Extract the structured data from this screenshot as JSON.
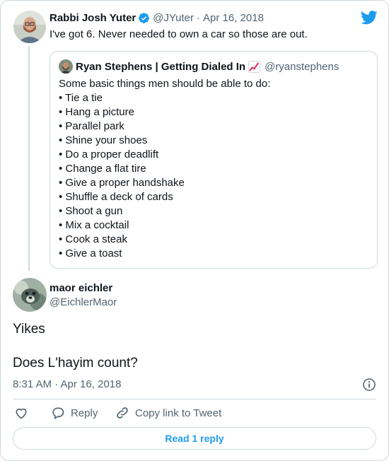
{
  "tweet1": {
    "name": "Rabbi Josh Yuter",
    "handle": "@JYuter",
    "dot": "·",
    "date": "Apr 16, 2018",
    "text": "I've got 6. Never needed to own a car so those are out."
  },
  "quoted": {
    "name": "Ryan Stephens | Getting Dialed In",
    "handle": "@ryanstephens",
    "intro": "Some basic things men should be able to do:",
    "items": [
      "• Tie a tie",
      "• Hang a picture",
      "• Parallel park",
      "• Shine your shoes",
      "• Do a proper deadlift",
      "• Change a flat tire",
      "• Give a proper handshake",
      "• Shuffle a deck of cards",
      "• Shoot a gun",
      "• Mix a cocktail",
      "• Cook a steak",
      "• Give a toast"
    ]
  },
  "tweet2": {
    "name": "maor eichler",
    "handle": "@EichlerMaor",
    "line1": "Yikes",
    "line2": "Does L'hayim count?",
    "timestamp": "8:31 AM · Apr 16, 2018"
  },
  "actions": {
    "reply": "Reply",
    "copy_link": "Copy link to Tweet",
    "read_replies": "Read 1 reply"
  },
  "colors": {
    "twitter_blue": "#1d9bf0",
    "verified_blue": "#1d9bf0",
    "text": "#0f1419",
    "muted": "#536471",
    "border": "#cfd9de"
  },
  "icons": [
    "twitter-bird-icon",
    "verified-badge-icon",
    "chart-increasing-emoji-icon",
    "info-icon",
    "heart-icon",
    "reply-icon",
    "link-icon"
  ]
}
